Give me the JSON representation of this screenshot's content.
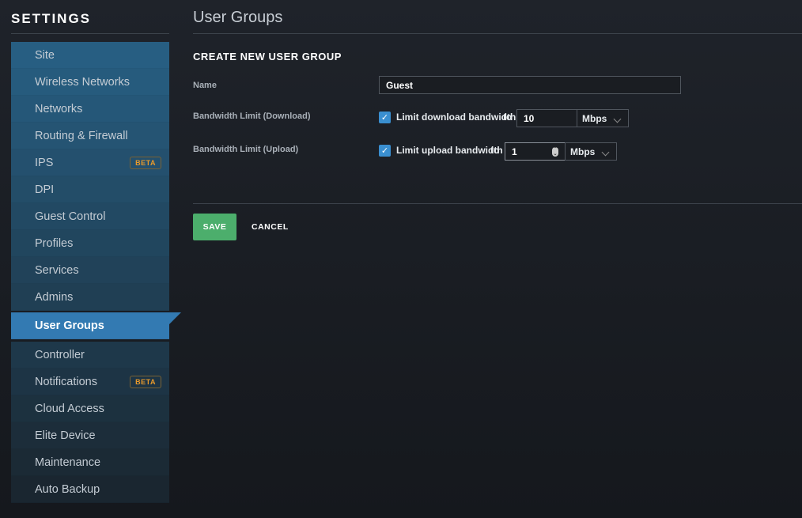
{
  "sidebar": {
    "title": "SETTINGS",
    "items": [
      {
        "label": "Site"
      },
      {
        "label": "Wireless Networks"
      },
      {
        "label": "Networks"
      },
      {
        "label": "Routing & Firewall"
      },
      {
        "label": "IPS",
        "badge": "BETA"
      },
      {
        "label": "DPI"
      },
      {
        "label": "Guest Control"
      },
      {
        "label": "Profiles"
      },
      {
        "label": "Services"
      },
      {
        "label": "Admins"
      },
      {
        "label": "User Groups",
        "active": true
      },
      {
        "label": "Controller"
      },
      {
        "label": "Notifications",
        "badge": "BETA"
      },
      {
        "label": "Cloud Access"
      },
      {
        "label": "Elite Device"
      },
      {
        "label": "Maintenance"
      },
      {
        "label": "Auto Backup"
      }
    ]
  },
  "main": {
    "title": "User Groups",
    "section_title": "CREATE NEW USER GROUP",
    "name": {
      "label": "Name",
      "value": "Guest"
    },
    "download": {
      "label": "Bandwidth Limit (Download)",
      "checked": true,
      "checkbox_label": "Limit download bandwidth",
      "to": "to",
      "value": "10",
      "unit": "Mbps"
    },
    "upload": {
      "label": "Bandwidth Limit (Upload)",
      "checked": true,
      "checkbox_label": "Limit upload bandwidth",
      "to": "to",
      "value": "1",
      "unit": "Mbps"
    },
    "save_label": "SAVE",
    "cancel_label": "CANCEL"
  },
  "colors": {
    "accent": "#337ab2",
    "save": "#4cae6c",
    "beta": "#e89a2c"
  }
}
